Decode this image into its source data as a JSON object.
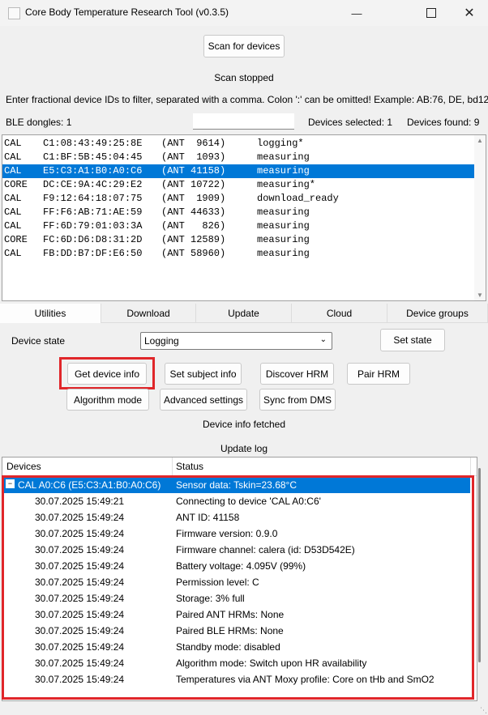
{
  "window": {
    "title": "Core Body Temperature Research Tool (v0.3.5)",
    "minimize_icon": "minimize-icon",
    "maximize_icon": "maximize-icon",
    "close_icon": "close-icon"
  },
  "scan": {
    "button_label": "Scan for devices",
    "status": "Scan stopped",
    "filter_hint": "Enter fractional device IDs to filter, separated with a comma. Colon ':' can be omitted! Example: AB:76, DE, bd12",
    "filter_value": "",
    "ble_dongles": "BLE dongles: 1",
    "devices_selected": "Devices selected: 1",
    "devices_found": "Devices found: 9"
  },
  "devices": [
    {
      "type": "CAL",
      "mac": "C1:08:43:49:25:8E",
      "ant": "(ANT  9614)",
      "state": "logging*",
      "selected": false
    },
    {
      "type": "CAL",
      "mac": "C1:BF:5B:45:04:45",
      "ant": "(ANT  1093)",
      "state": "measuring",
      "selected": false
    },
    {
      "type": "CAL",
      "mac": "E5:C3:A1:B0:A0:C6",
      "ant": "(ANT 41158)",
      "state": "measuring",
      "selected": true
    },
    {
      "type": "CORE",
      "mac": "DC:CE:9A:4C:29:E2",
      "ant": "(ANT 10722)",
      "state": "measuring*",
      "selected": false
    },
    {
      "type": "CAL",
      "mac": "F9:12:64:18:07:75",
      "ant": "(ANT  1909)",
      "state": "download_ready",
      "selected": false
    },
    {
      "type": "CAL",
      "mac": "FF:F6:AB:71:AE:59",
      "ant": "(ANT 44633)",
      "state": "measuring",
      "selected": false
    },
    {
      "type": "CAL",
      "mac": "FF:6D:79:01:03:3A",
      "ant": "(ANT   826)",
      "state": "measuring",
      "selected": false
    },
    {
      "type": "CORE",
      "mac": "FC:6D:D6:D8:31:2D",
      "ant": "(ANT 12589)",
      "state": "measuring",
      "selected": false
    },
    {
      "type": "CAL",
      "mac": "FB:DD:B7:DF:E6:50",
      "ant": "(ANT 58960)",
      "state": "measuring",
      "selected": false
    }
  ],
  "tabs": [
    "Utilities",
    "Download",
    "Update",
    "Cloud",
    "Device groups"
  ],
  "utilities": {
    "device_state_label": "Device state",
    "device_state_value": "Logging",
    "set_state": "Set state",
    "get_device_info": "Get device info",
    "set_subject_info": "Set subject info",
    "discover_hrm": "Discover HRM",
    "pair_hrm": "Pair HRM",
    "algorithm_mode": "Algorithm mode",
    "advanced_settings": "Advanced settings",
    "sync_from_dms": "Sync from DMS",
    "status": "Device info fetched"
  },
  "log": {
    "title": "Update log",
    "col_devices": "Devices",
    "col_status": "Status",
    "parent": {
      "device": "CAL A0:C6 (E5:C3:A1:B0:A0:C6)",
      "status": "Sensor data: Tskin=23.68°C"
    },
    "entries": [
      {
        "time": "30.07.2025 15:49:21",
        "status": "Connecting to device 'CAL A0:C6'"
      },
      {
        "time": "30.07.2025 15:49:24",
        "status": "ANT ID: 41158"
      },
      {
        "time": "30.07.2025 15:49:24",
        "status": "Firmware version: 0.9.0"
      },
      {
        "time": "30.07.2025 15:49:24",
        "status": "Firmware channel: calera (id: D53D542E)"
      },
      {
        "time": "30.07.2025 15:49:24",
        "status": "Battery voltage: 4.095V (99%)"
      },
      {
        "time": "30.07.2025 15:49:24",
        "status": "Permission level: C"
      },
      {
        "time": "30.07.2025 15:49:24",
        "status": "Storage: 3% full"
      },
      {
        "time": "30.07.2025 15:49:24",
        "status": "Paired ANT HRMs: None"
      },
      {
        "time": "30.07.2025 15:49:24",
        "status": "Paired BLE HRMs: None"
      },
      {
        "time": "30.07.2025 15:49:24",
        "status": "Standby mode: disabled"
      },
      {
        "time": "30.07.2025 15:49:24",
        "status": "Algorithm mode: Switch upon HR availability"
      },
      {
        "time": "30.07.2025 15:49:24",
        "status": "Temperatures via ANT Moxy profile: Core on tHb and SmO2"
      }
    ]
  },
  "colors": {
    "selection": "#0078d7",
    "highlight": "#e0262a"
  }
}
